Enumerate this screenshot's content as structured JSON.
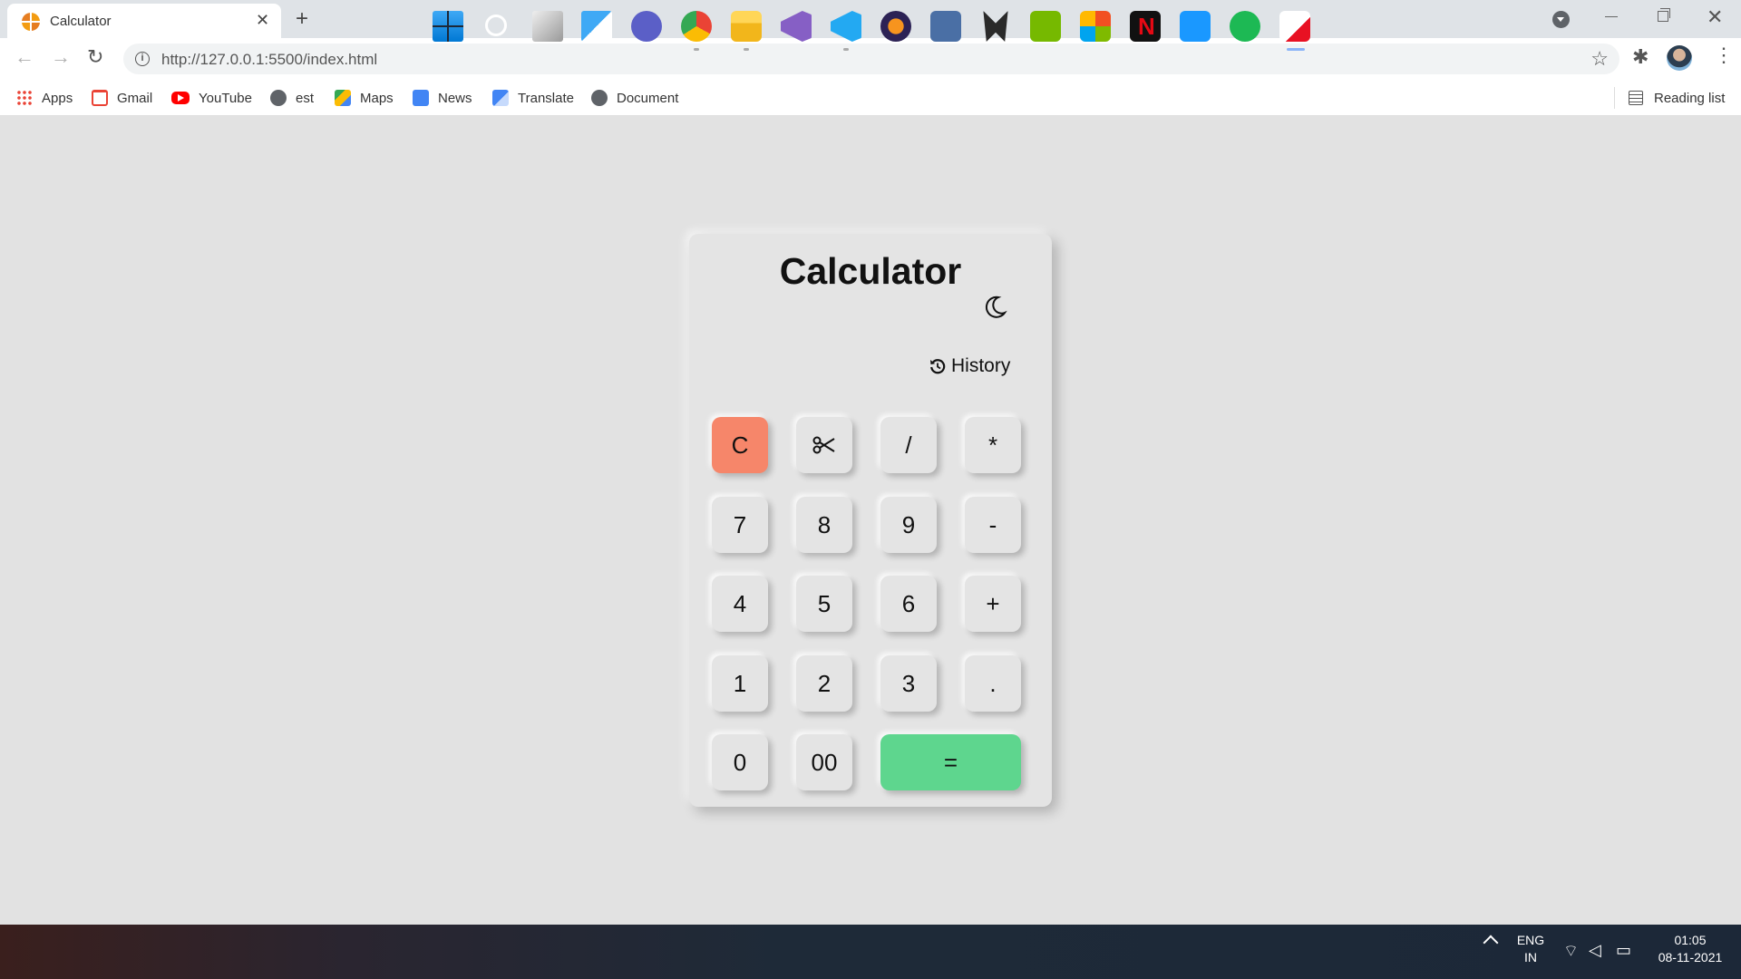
{
  "browser": {
    "tab_title": "Calculator",
    "tab_close": "✕",
    "new_tab": "+",
    "url": "http://127.0.0.1:5500/index.html",
    "bookmarks": [
      "Apps",
      "Gmail",
      "YouTube",
      "est",
      "Maps",
      "News",
      "Translate",
      "Document"
    ],
    "reading_list": "Reading list"
  },
  "calculator": {
    "title": "Calculator",
    "display": "",
    "history_label": "History",
    "keys": [
      {
        "label": "C",
        "type": "clear"
      },
      {
        "label": "",
        "type": "cut",
        "icon": "scissors-icon"
      },
      {
        "label": "/",
        "type": "op"
      },
      {
        "label": "*",
        "type": "op"
      },
      {
        "label": "7"
      },
      {
        "label": "8"
      },
      {
        "label": "9"
      },
      {
        "label": "-",
        "type": "op"
      },
      {
        "label": "4"
      },
      {
        "label": "5"
      },
      {
        "label": "6"
      },
      {
        "label": "+",
        "type": "op"
      },
      {
        "label": "1"
      },
      {
        "label": "2"
      },
      {
        "label": "3"
      },
      {
        "label": ".",
        "type": "op"
      },
      {
        "label": "0"
      },
      {
        "label": "00"
      },
      {
        "label": "=",
        "type": "equals"
      }
    ],
    "colors": {
      "clear": "#f6866a",
      "equals": "#5ed68e",
      "surface": "#e4e4e4"
    }
  },
  "taskbar": {
    "language": "ENG",
    "region": "IN",
    "time": "01:05",
    "date": "08-11-2021"
  }
}
